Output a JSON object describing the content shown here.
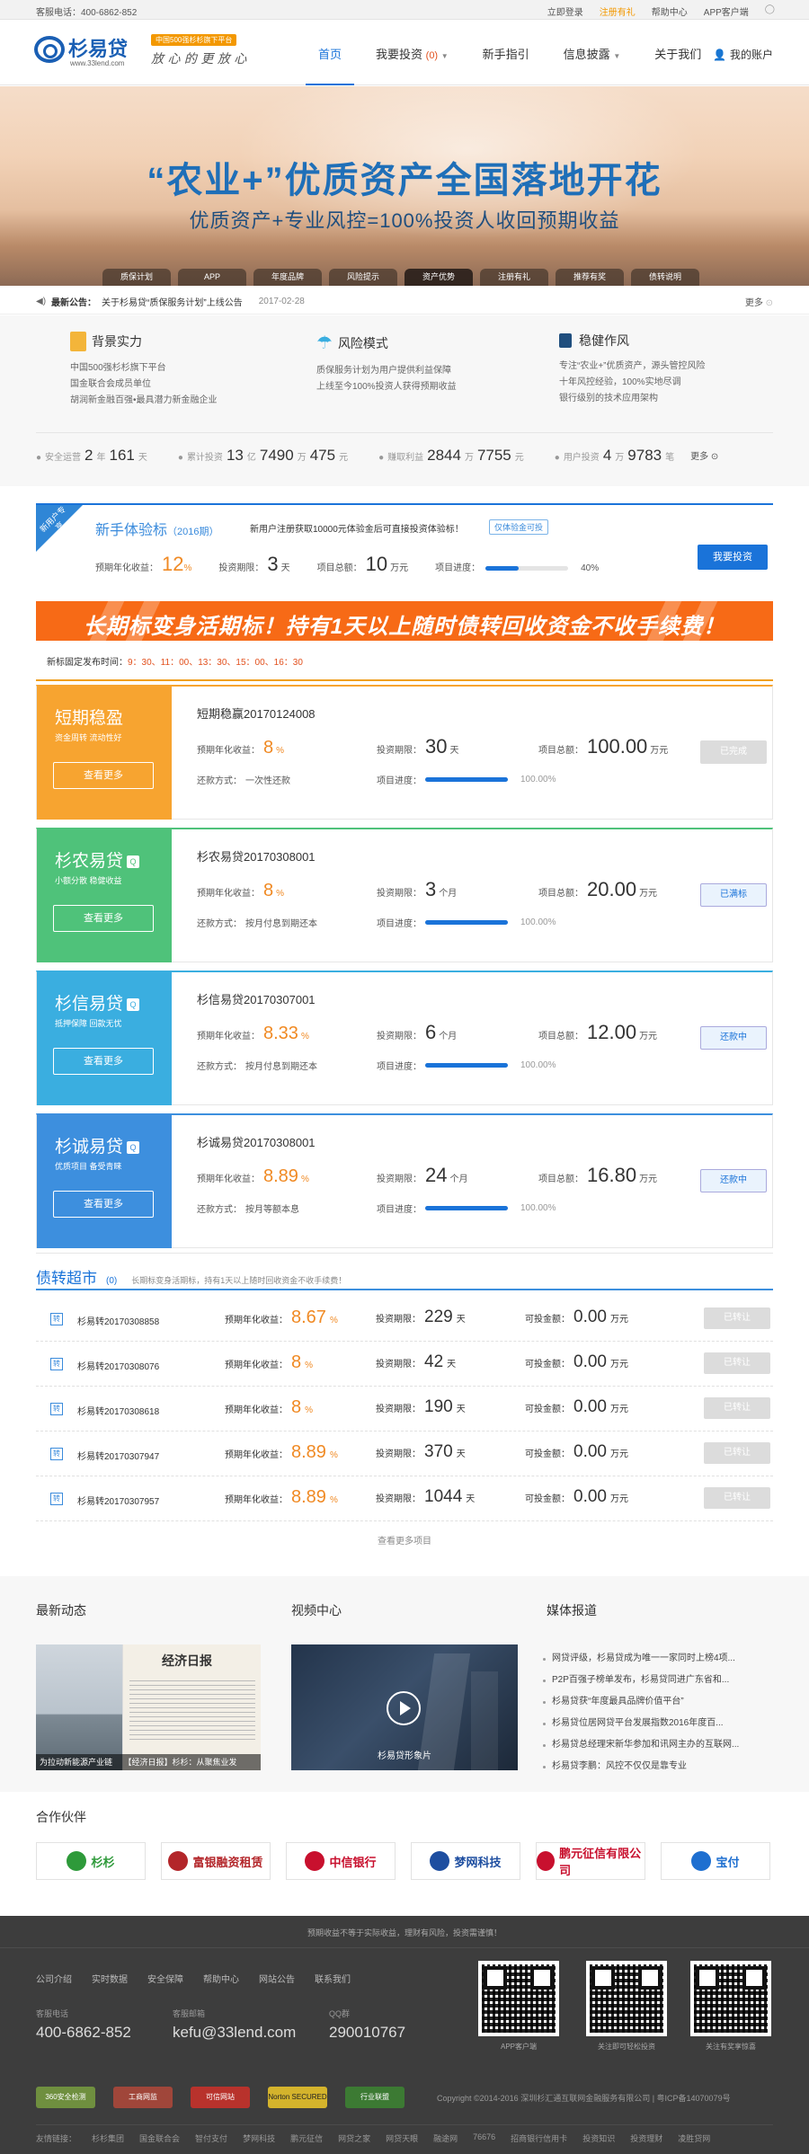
{
  "topbar": {
    "phone": "客服电话：400-6862-852",
    "links": [
      "立即登录",
      "注册有礼",
      "帮助中心",
      "APP客户端"
    ]
  },
  "header": {
    "logo": "杉易贷",
    "url": "www.33lend.com",
    "badge": "中国500强杉杉旗下平台",
    "slogan": "放 心 的   更 放 心",
    "nav": [
      {
        "label": "首页",
        "active": true
      },
      {
        "label": "我要投资",
        "count": "(0)"
      },
      {
        "label": "新手指引"
      },
      {
        "label": "信息披露"
      },
      {
        "label": "关于我们"
      }
    ],
    "account": "我的账户"
  },
  "banner": {
    "headline": "“农业+”优质资产全国落地开花",
    "sub": "优质资产+专业风控=100%投资人收回预期收益",
    "tabs": [
      "质保计划",
      "APP",
      "年度品牌",
      "风险提示",
      "资产优势",
      "注册有礼",
      "推荐有奖",
      "债转说明"
    ]
  },
  "notice": {
    "label": "最新公告：",
    "text": "关于杉易贷“质保服务计划”上线公告",
    "date": "2017-02-28",
    "more": "更多"
  },
  "features": [
    {
      "title": "背景实力",
      "lines": [
        "中国500强杉杉旗下平台",
        "国金联合会成员单位",
        "胡润新金融百强•最具潜力新金融企业"
      ]
    },
    {
      "title": "风险模式",
      "lines": [
        "质保服务计划为用户提供利益保障",
        "上线至今100%投资人获得预期收益"
      ]
    },
    {
      "title": "稳健作风",
      "lines": [
        "专注“农业+”优质资产，源头管控风险",
        "十年风控经验，100%实地尽调",
        "银行级别的技术应用架构"
      ]
    }
  ],
  "stats": {
    "safe": {
      "label": "安全运营",
      "y": "2",
      "yu": "年",
      "d": "161",
      "du": "天"
    },
    "invest": {
      "label": "累计投资",
      "a": "13",
      "au": "亿",
      "b": "7490",
      "bu": "万",
      "c": "475",
      "cu": "元"
    },
    "earn": {
      "label": "赚取利益",
      "a": "2844",
      "au": "万",
      "b": "7755",
      "bu": "元"
    },
    "users": {
      "label": "用户投资",
      "a": "4",
      "au": "万",
      "b": "9783",
      "bu": "笔"
    },
    "more": "更多"
  },
  "newbie": {
    "corner": "新用户专享",
    "title": "新手体验标",
    "year": "（2016期）",
    "desc": "新用户注册获取10000元体验金后可直接投资体验标！",
    "tag": "仅体验金可投",
    "rate_label": "预期年化收益：",
    "rate": "12",
    "rate_unit": "%",
    "period_label": "投资期限：",
    "period": "3",
    "period_unit": "天",
    "total_label": "项目总额：",
    "total": "10",
    "total_unit": "万元",
    "progress_label": "项目进度：",
    "progress": "40%",
    "progress_value": 0.4,
    "button": "我要投资"
  },
  "promo": "长期标变身活期标！持有1天以上随时债转回收资金不收手续费！",
  "schedule": {
    "label": "新标固定发布时间：",
    "times": "9：30、11：00、13：30、15：00、16：30"
  },
  "products": [
    {
      "name": "短期稳盈",
      "q": "",
      "sub": "资金周转 流动性好",
      "more": "查看更多",
      "color": "#f7a430",
      "title": "短期稳赢20170124008",
      "rate": "8",
      "period": "30",
      "period_unit": "天",
      "total": "100.00",
      "repay": "一次性还款",
      "progress": "100.00%",
      "progress_value": 1,
      "button": "已完成",
      "btn_state": "dis"
    },
    {
      "name": "杉农易贷",
      "q": "Q",
      "sub": "小额分散 稳健收益",
      "more": "查看更多",
      "color": "#4fc27a",
      "title": "杉农易贷20170308001",
      "rate": "8",
      "period": "3",
      "period_unit": "个月",
      "total": "20.00",
      "repay": "按月付息到期还本",
      "progress": "100.00%",
      "progress_value": 1,
      "button": "已满标",
      "btn_state": "on"
    },
    {
      "name": "杉信易贷",
      "q": "Q",
      "sub": "抵押保障 回款无忧",
      "more": "查看更多",
      "color": "#3aaee0",
      "title": "杉信易贷20170307001",
      "rate": "8.33",
      "period": "6",
      "period_unit": "个月",
      "total": "12.00",
      "repay": "按月付息到期还本",
      "progress": "100.00%",
      "progress_value": 1,
      "button": "还款中",
      "btn_state": "on"
    },
    {
      "name": "杉诚易贷",
      "q": "Q",
      "sub": "优质项目 备受青睐",
      "more": "查看更多",
      "color": "#3d8fde",
      "title": "杉诚易贷20170308001",
      "rate": "8.89",
      "period": "24",
      "period_unit": "个月",
      "total": "16.80",
      "repay": "按月等额本息",
      "progress": "100.00%",
      "progress_value": 1,
      "button": "还款中",
      "btn_state": "on"
    }
  ],
  "labels": {
    "rate": "预期年化收益：",
    "period": "投资期限：",
    "total": "项目总额：",
    "repay": "还款方式：",
    "progress": "项目进度：",
    "pct": "%",
    "wan": "万元",
    "day": "天",
    "amount": "可投金额："
  },
  "market": {
    "title": "债转超市",
    "count": "(0)",
    "desc": "长期标变身活期标，持有1天以上随时回收资金不收手续费！",
    "rows": [
      {
        "name": "杉易转20170308858",
        "rate": "8.67",
        "period": "229",
        "amount": "0.00",
        "button": "已转让"
      },
      {
        "name": "杉易转20170308076",
        "rate": "8",
        "period": "42",
        "amount": "0.00",
        "button": "已转让"
      },
      {
        "name": "杉易转20170308618",
        "rate": "8",
        "period": "190",
        "amount": "0.00",
        "button": "已转让"
      },
      {
        "name": "杉易转20170307947",
        "rate": "8.89",
        "period": "370",
        "amount": "0.00",
        "button": "已转让"
      },
      {
        "name": "杉易转20170307957",
        "rate": "8.89",
        "period": "1044",
        "amount": "0.00",
        "button": "已转让"
      }
    ],
    "more": "查看更多项目"
  },
  "news": {
    "t1": "最新动态",
    "t2": "视频中心",
    "t3": "媒体报道",
    "caption": "为拉动新能源产业链",
    "caption2": "【经济日报】杉杉：从聚焦业发",
    "newspaper": "经济日报",
    "video_caption": "杉易贷形象片",
    "media": [
      "网贷评级，杉易贷成为唯一一家同时上榜4项...",
      "P2P百强子榜单发布，杉易贷同进广东省和...",
      "杉易贷获“年度最具品牌价值平台”",
      "杉易贷位居网贷平台发展指数2016年度百...",
      "杉易贷总经理宋新华参加和讯网主办的互联网...",
      "杉易贷李鹏：风控不仅仅是靠专业"
    ]
  },
  "partners": {
    "title": "合作伙伴",
    "logos": [
      {
        "text": "杉杉",
        "color": "#2e9a3a"
      },
      {
        "text": "富银融资租赁",
        "color": "#b3262a"
      },
      {
        "text": "中信银行",
        "color": "#c8102e"
      },
      {
        "text": "梦网科技",
        "color": "#1e4ea0"
      },
      {
        "text": "鹏元征信有限公司",
        "color": "#c8102e"
      },
      {
        "text": "宝付",
        "color": "#1e6fd0"
      }
    ]
  },
  "footer": {
    "risk": "预期收益不等于实际收益，理财有风险，投资需谨慎！",
    "links": [
      "公司介绍",
      "实时数据",
      "安全保障",
      "帮助中心",
      "网站公告",
      "联系我们"
    ],
    "phone_label": "客服电话",
    "phone": "400-6862-852",
    "mail_label": "客服邮箱",
    "mail": "kefu@33lend.com",
    "qq_label": "QQ群",
    "qq": "290010767",
    "qr": [
      "APP客户端",
      "关注即可轻松投资",
      "关注有奖享惊喜"
    ],
    "certs": [
      "360安全检测",
      "工商网监",
      "可信网站",
      "Norton SECURED",
      "行业联盟"
    ],
    "copyright": "Copyright ©2014-2016 深圳杉汇通互联网金融服务有限公司 | 粤ICP备14070079号",
    "friend_label": "友情链接：",
    "friends": [
      "杉杉集团",
      "国金联合会",
      "智付支付",
      "梦网科技",
      "鹏元征信",
      "网贷之家",
      "网贷天眼",
      "融途网",
      "76676",
      "招商银行信用卡",
      "投资知识",
      "投资理财",
      "凌胜贷网"
    ]
  }
}
